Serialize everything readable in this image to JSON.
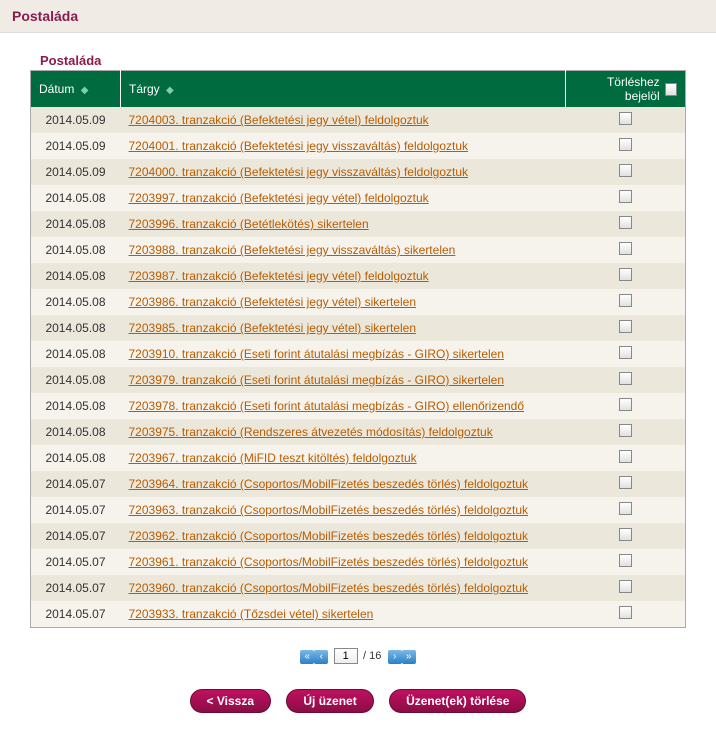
{
  "page_title": "Postaláda",
  "section_title": "Postaláda",
  "columns": {
    "date": "Dátum",
    "subject": "Tárgy",
    "delete_mark": "Törléshez bejelöl"
  },
  "rows": [
    {
      "date": "2014.05.09",
      "subject": "7204003. tranzakció (Befektetési jegy vétel) feldolgoztuk"
    },
    {
      "date": "2014.05.09",
      "subject": "7204001. tranzakció (Befektetési jegy visszaváltás) feldolgoztuk"
    },
    {
      "date": "2014.05.09",
      "subject": "7204000. tranzakció (Befektetési jegy visszaváltás) feldolgoztuk"
    },
    {
      "date": "2014.05.08",
      "subject": "7203997. tranzakció (Befektetési jegy vétel) feldolgoztuk"
    },
    {
      "date": "2014.05.08",
      "subject": "7203996. tranzakció (Betétlekötés) sikertelen"
    },
    {
      "date": "2014.05.08",
      "subject": "7203988. tranzakció (Befektetési jegy visszaváltás) sikertelen"
    },
    {
      "date": "2014.05.08",
      "subject": "7203987. tranzakció (Befektetési jegy vétel) feldolgoztuk"
    },
    {
      "date": "2014.05.08",
      "subject": "7203986. tranzakció (Befektetési jegy vétel) sikertelen"
    },
    {
      "date": "2014.05.08",
      "subject": "7203985. tranzakció (Befektetési jegy vétel) sikertelen"
    },
    {
      "date": "2014.05.08",
      "subject": "7203910. tranzakció (Eseti forint átutalási megbízás - GIRO) sikertelen"
    },
    {
      "date": "2014.05.08",
      "subject": "7203979. tranzakció (Eseti forint átutalási megbízás - GIRO) sikertelen"
    },
    {
      "date": "2014.05.08",
      "subject": "7203978. tranzakció (Eseti forint átutalási megbízás - GIRO) ellenőrizendő"
    },
    {
      "date": "2014.05.08",
      "subject": "7203975. tranzakció (Rendszeres átvezetés módosítás) feldolgoztuk"
    },
    {
      "date": "2014.05.08",
      "subject": "7203967. tranzakció (MiFID teszt kitöltés) feldolgoztuk"
    },
    {
      "date": "2014.05.07",
      "subject": "7203964. tranzakció (Csoportos/MobilFizetés beszedés törlés) feldolgoztuk"
    },
    {
      "date": "2014.05.07",
      "subject": "7203963. tranzakció (Csoportos/MobilFizetés beszedés törlés) feldolgoztuk"
    },
    {
      "date": "2014.05.07",
      "subject": "7203962. tranzakció (Csoportos/MobilFizetés beszedés törlés) feldolgoztuk"
    },
    {
      "date": "2014.05.07",
      "subject": "7203961. tranzakció (Csoportos/MobilFizetés beszedés törlés) feldolgoztuk"
    },
    {
      "date": "2014.05.07",
      "subject": "7203960. tranzakció (Csoportos/MobilFizetés beszedés törlés) feldolgoztuk"
    },
    {
      "date": "2014.05.07",
      "subject": "7203933. tranzakció (Tőzsdei vétel) sikertelen"
    }
  ],
  "pager": {
    "first_icon": "«",
    "prev_icon": "‹",
    "current": "1",
    "total_text": "/ 16",
    "next_icon": "›",
    "last_icon": "»"
  },
  "actions": {
    "back": "< Vissza",
    "new_message": "Új üzenet",
    "delete": "Üzenet(ek) törlése"
  }
}
